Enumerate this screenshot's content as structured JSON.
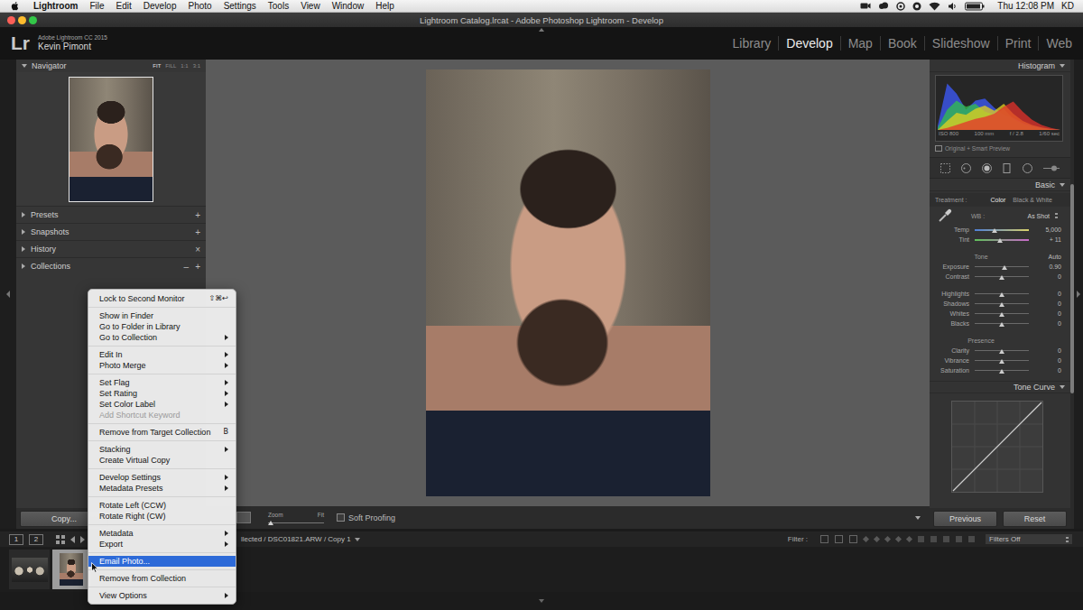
{
  "menubar": {
    "app": "Lightroom",
    "items": [
      "File",
      "Edit",
      "Develop",
      "Photo",
      "Settings",
      "Tools",
      "View",
      "Window",
      "Help"
    ],
    "clock": "Thu 12:08 PM",
    "user": "KD"
  },
  "window": {
    "title": "Lightroom Catalog.lrcat - Adobe Photoshop Lightroom - Develop"
  },
  "identity": {
    "logo": "Lr",
    "product": "Adobe Lightroom CC 2015",
    "user": "Kevin Pimont"
  },
  "modules": [
    {
      "label": "Library",
      "selected": false
    },
    {
      "label": "Develop",
      "selected": true
    },
    {
      "label": "Map",
      "selected": false
    },
    {
      "label": "Book",
      "selected": false
    },
    {
      "label": "Slideshow",
      "selected": false
    },
    {
      "label": "Print",
      "selected": false
    },
    {
      "label": "Web",
      "selected": false
    }
  ],
  "left_panel": {
    "navigator": {
      "title": "Navigator",
      "zoom": [
        {
          "label": "FIT",
          "selected": true
        },
        {
          "label": "FILL",
          "selected": false
        },
        {
          "label": "1:1",
          "selected": false
        },
        {
          "label": "3:1",
          "selected": false
        }
      ]
    },
    "sections": [
      {
        "title": "Presets",
        "actions": [
          "+"
        ]
      },
      {
        "title": "Snapshots",
        "actions": [
          "+"
        ]
      },
      {
        "title": "History",
        "actions": [
          "×"
        ]
      },
      {
        "title": "Collections",
        "actions": [
          "–",
          "+"
        ]
      }
    ],
    "copy_button": "Copy..."
  },
  "toolbar": {
    "zoom_label": "Zoom",
    "zoom_value": "Fit",
    "zoom_level": 0.05,
    "soft_proofing": "Soft Proofing",
    "soft_proofing_checked": false
  },
  "right_panel": {
    "histogram": {
      "title": "Histogram",
      "info": [
        "ISO 800",
        "100 mm",
        "f / 2.8",
        "1/60 sec"
      ],
      "series": [
        {
          "name": "blue",
          "color": "#3d5bff",
          "values": [
            8,
            92,
            72,
            40,
            58,
            62,
            44,
            30,
            24,
            14,
            8,
            4,
            2,
            0
          ]
        },
        {
          "name": "green",
          "color": "#33c24a",
          "values": [
            4,
            40,
            58,
            46,
            52,
            36,
            30,
            42,
            22,
            12,
            6,
            3,
            1,
            0
          ]
        },
        {
          "name": "yellow",
          "color": "#e6d21e",
          "values": [
            0,
            18,
            34,
            30,
            42,
            48,
            38,
            52,
            32,
            18,
            10,
            5,
            2,
            0
          ]
        },
        {
          "name": "red",
          "color": "#e5322b",
          "values": [
            0,
            4,
            10,
            16,
            22,
            26,
            32,
            46,
            56,
            36,
            20,
            10,
            4,
            0
          ]
        }
      ]
    },
    "preview_label": "Original + Smart Preview",
    "basic": {
      "title": "Basic",
      "treatment_label": "Treatment :",
      "treatments": [
        {
          "label": "Color",
          "selected": true
        },
        {
          "label": "Black & White",
          "selected": false
        }
      ],
      "wb_label": "WB :",
      "wb_value": "As Shot",
      "wb_sliders": [
        {
          "label": "Temp",
          "value": "5,000",
          "level": 0.36,
          "kind": "temp"
        },
        {
          "label": "Tint",
          "value": "+ 11",
          "level": 0.47,
          "kind": "tint"
        }
      ],
      "groups": [
        {
          "title": "Tone",
          "action": "Auto",
          "sliders": [
            {
              "label": "Exposure",
              "value": "0.90",
              "level": 0.55,
              "kind": "plain"
            },
            {
              "label": "Contrast",
              "value": "0",
              "level": 0.5,
              "kind": "plain"
            },
            {
              "label": "Highlights",
              "value": "0",
              "level": 0.5,
              "kind": "plain"
            },
            {
              "label": "Shadows",
              "value": "0",
              "level": 0.5,
              "kind": "plain"
            },
            {
              "label": "Whites",
              "value": "0",
              "level": 0.5,
              "kind": "plain"
            },
            {
              "label": "Blacks",
              "value": "0",
              "level": 0.5,
              "kind": "plain"
            }
          ]
        },
        {
          "title": "Presence",
          "action": "",
          "sliders": [
            {
              "label": "Clarity",
              "value": "0",
              "level": 0.5,
              "kind": "plain"
            },
            {
              "label": "Vibrance",
              "value": "0",
              "level": 0.5,
              "kind": "plain"
            },
            {
              "label": "Saturation",
              "value": "0",
              "level": 0.5,
              "kind": "plain"
            }
          ]
        }
      ]
    },
    "tone_curve": {
      "title": "Tone Curve"
    },
    "buttons": [
      "Previous",
      "Reset"
    ]
  },
  "filmstrip": {
    "pages": [
      "1",
      "2"
    ],
    "source": "llected / DSC01821.ARW / Copy 1",
    "filter_label": "Filter :",
    "filter_value": "Filters Off",
    "thumbnails": [
      {
        "kind": "group",
        "selected": false
      },
      {
        "kind": "portrait",
        "selected": true
      }
    ]
  },
  "context_menu": {
    "items": [
      {
        "kind": "item",
        "label": "Lock to Second Monitor",
        "shortcut": "⇧⌘↩",
        "submenu": false,
        "disabled": false,
        "selected": false
      },
      {
        "kind": "separator"
      },
      {
        "kind": "item",
        "label": "Show in Finder",
        "shortcut": "",
        "submenu": false,
        "disabled": false,
        "selected": false
      },
      {
        "kind": "item",
        "label": "Go to Folder in Library",
        "shortcut": "",
        "submenu": false,
        "disabled": false,
        "selected": false
      },
      {
        "kind": "item",
        "label": "Go to Collection",
        "shortcut": "",
        "submenu": true,
        "disabled": false,
        "selected": false
      },
      {
        "kind": "separator"
      },
      {
        "kind": "item",
        "label": "Edit In",
        "shortcut": "",
        "submenu": true,
        "disabled": false,
        "selected": false
      },
      {
        "kind": "item",
        "label": "Photo Merge",
        "shortcut": "",
        "submenu": true,
        "disabled": false,
        "selected": false
      },
      {
        "kind": "separator"
      },
      {
        "kind": "item",
        "label": "Set Flag",
        "shortcut": "",
        "submenu": true,
        "disabled": false,
        "selected": false
      },
      {
        "kind": "item",
        "label": "Set Rating",
        "shortcut": "",
        "submenu": true,
        "disabled": false,
        "selected": false
      },
      {
        "kind": "item",
        "label": "Set Color Label",
        "shortcut": "",
        "submenu": true,
        "disabled": false,
        "selected": false
      },
      {
        "kind": "item",
        "label": "Add Shortcut Keyword",
        "shortcut": "",
        "submenu": false,
        "disabled": true,
        "selected": false
      },
      {
        "kind": "separator"
      },
      {
        "kind": "item",
        "label": "Remove from Target Collection",
        "shortcut": "B",
        "submenu": false,
        "disabled": false,
        "selected": false
      },
      {
        "kind": "separator"
      },
      {
        "kind": "item",
        "label": "Stacking",
        "shortcut": "",
        "submenu": true,
        "disabled": false,
        "selected": false
      },
      {
        "kind": "item",
        "label": "Create Virtual Copy",
        "shortcut": "",
        "submenu": false,
        "disabled": false,
        "selected": false
      },
      {
        "kind": "separator"
      },
      {
        "kind": "item",
        "label": "Develop Settings",
        "shortcut": "",
        "submenu": true,
        "disabled": false,
        "selected": false
      },
      {
        "kind": "item",
        "label": "Metadata Presets",
        "shortcut": "",
        "submenu": true,
        "disabled": false,
        "selected": false
      },
      {
        "kind": "separator"
      },
      {
        "kind": "item",
        "label": "Rotate Left (CCW)",
        "shortcut": "",
        "submenu": false,
        "disabled": false,
        "selected": false
      },
      {
        "kind": "item",
        "label": "Rotate Right (CW)",
        "shortcut": "",
        "submenu": false,
        "disabled": false,
        "selected": false
      },
      {
        "kind": "separator"
      },
      {
        "kind": "item",
        "label": "Metadata",
        "shortcut": "",
        "submenu": true,
        "disabled": false,
        "selected": false
      },
      {
        "kind": "item",
        "label": "Export",
        "shortcut": "",
        "submenu": true,
        "disabled": false,
        "selected": false
      },
      {
        "kind": "separator"
      },
      {
        "kind": "item",
        "label": "Email Photo...",
        "shortcut": "",
        "submenu": false,
        "disabled": false,
        "selected": true
      },
      {
        "kind": "separator"
      },
      {
        "kind": "item",
        "label": "Remove from Collection",
        "shortcut": "",
        "submenu": false,
        "disabled": false,
        "selected": false
      },
      {
        "kind": "separator"
      },
      {
        "kind": "item",
        "label": "View Options",
        "shortcut": "",
        "submenu": true,
        "disabled": false,
        "selected": false
      }
    ]
  }
}
